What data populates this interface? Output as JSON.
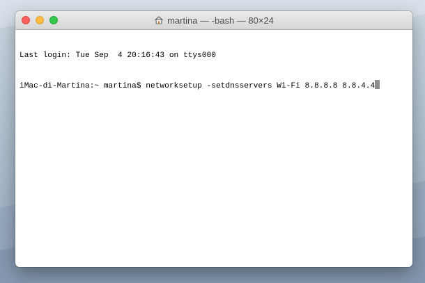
{
  "window": {
    "title": "martina — -bash — 80×24"
  },
  "terminal": {
    "lines": [
      "Last login: Tue Sep  4 20:16:43 on ttys000",
      "iMac-di-Martina:~ martina$ networksetup -setdnsservers Wi-Fi 8.8.8.8 8.8.4.4"
    ]
  },
  "icons": {
    "title_icon": "home-icon"
  },
  "colors": {
    "close": "#fc605c",
    "minimize": "#fdbc40",
    "zoom": "#34c84a",
    "cursor": "#8e8e8e"
  }
}
